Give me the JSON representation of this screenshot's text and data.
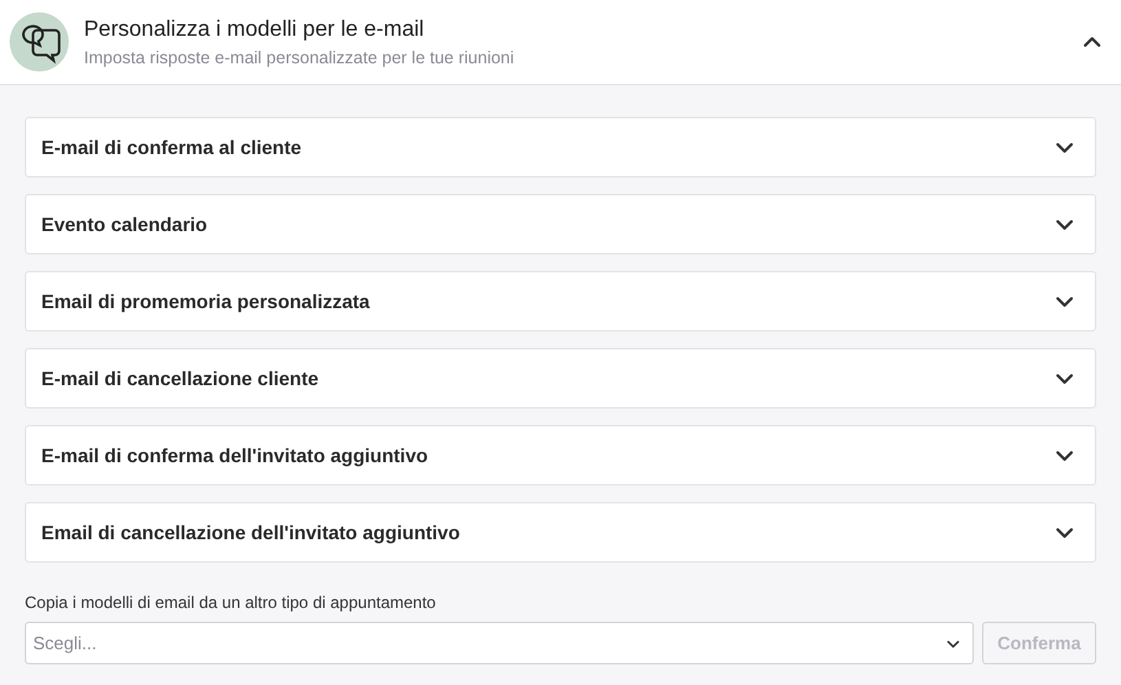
{
  "section": {
    "title": "Personalizza i modelli per le e-mail",
    "subtitle": "Imposta risposte e-mail personalizzate per le tue riunioni",
    "expanded": true
  },
  "templates": [
    {
      "label": "E-mail di conferma al cliente",
      "expanded": false
    },
    {
      "label": "Evento calendario",
      "expanded": false
    },
    {
      "label": "Email di promemoria personalizzata",
      "expanded": false
    },
    {
      "label": "E-mail di cancellazione cliente",
      "expanded": false
    },
    {
      "label": "E-mail di conferma dell'invitato aggiuntivo",
      "expanded": false
    },
    {
      "label": "Email di cancellazione dell'invitato aggiuntivo",
      "expanded": false
    }
  ],
  "copy": {
    "label": "Copia i modelli di email da un altro tipo di appuntamento",
    "placeholder": "Scegli...",
    "button": {
      "label": "Conferma",
      "disabled": true
    }
  }
}
